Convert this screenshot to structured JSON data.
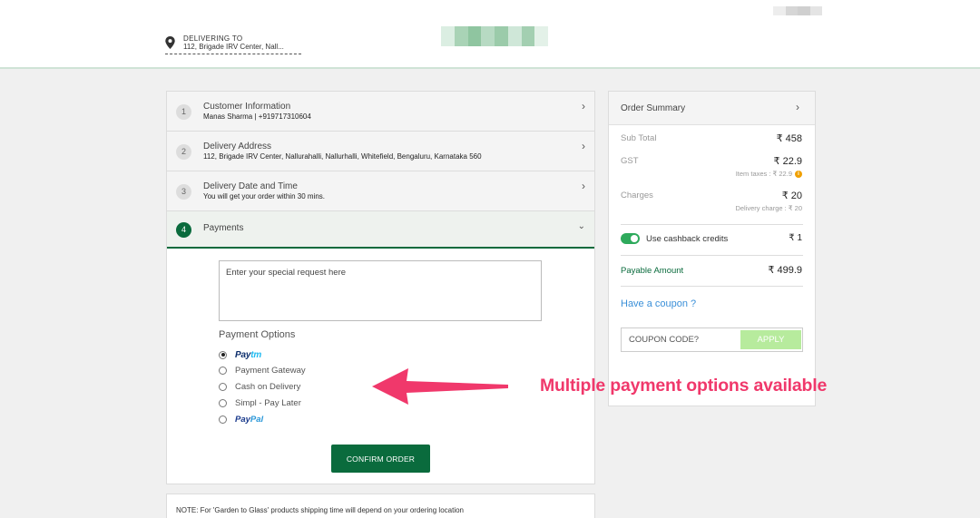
{
  "header": {
    "delivering_label": "DELIVERING TO",
    "delivering_address": "112, Brigade IRV Center, Nall..."
  },
  "steps": [
    {
      "num": "1",
      "title": "Customer Information",
      "sub": "Manas Sharma | +919717310604"
    },
    {
      "num": "2",
      "title": "Delivery Address",
      "sub": "112, Brigade IRV Center, Nallurahalli, Nallurhalli, Whitefield, Bengaluru, Karnataka 560"
    },
    {
      "num": "3",
      "title": "Delivery Date and Time",
      "sub": "You will get your order within 30 mins."
    },
    {
      "num": "4",
      "title": "Payments",
      "sub": ""
    }
  ],
  "payment": {
    "request_placeholder": "Enter your special request here",
    "options_heading": "Payment Options",
    "options": [
      {
        "label": "Paytm",
        "logo_part1": "Pay",
        "logo_part2": "tm",
        "selected": true
      },
      {
        "label": "Payment Gateway",
        "selected": false
      },
      {
        "label": "Cash on Delivery",
        "selected": false
      },
      {
        "label": "Simpl - Pay Later",
        "selected": false
      },
      {
        "label": "PayPal",
        "logo_part1": "Pay",
        "logo_part2": "Pal",
        "selected": false
      }
    ],
    "confirm_label": "CONFIRM ORDER"
  },
  "note": "NOTE: For 'Garden to Glass' products shipping time will depend on your ordering location",
  "summary": {
    "title": "Order Summary",
    "sub_total_label": "Sub Total",
    "sub_total_value": "₹ 458",
    "gst_label": "GST",
    "gst_value": "₹ 22.9",
    "gst_detail": "Item taxes : ₹ 22.9",
    "charges_label": "Charges",
    "charges_value": "₹ 20",
    "charges_detail": "Delivery charge : ₹ 20",
    "cashback_label": "Use cashback credits",
    "cashback_value": "₹ 1",
    "cashback_enabled": true,
    "payable_label": "Payable Amount",
    "payable_value": "₹ 499.9",
    "coupon_link": "Have a coupon ?",
    "coupon_placeholder": "COUPON CODE?",
    "apply_label": "APPLY"
  },
  "annotation": "Multiple payment options available",
  "colors": {
    "brand_green": "#0a6b3d",
    "toggle_green": "#2eaa5c",
    "link_blue": "#3a8fd8",
    "annotation_pink": "#f0386b",
    "apply_green": "#b7eb9d"
  }
}
